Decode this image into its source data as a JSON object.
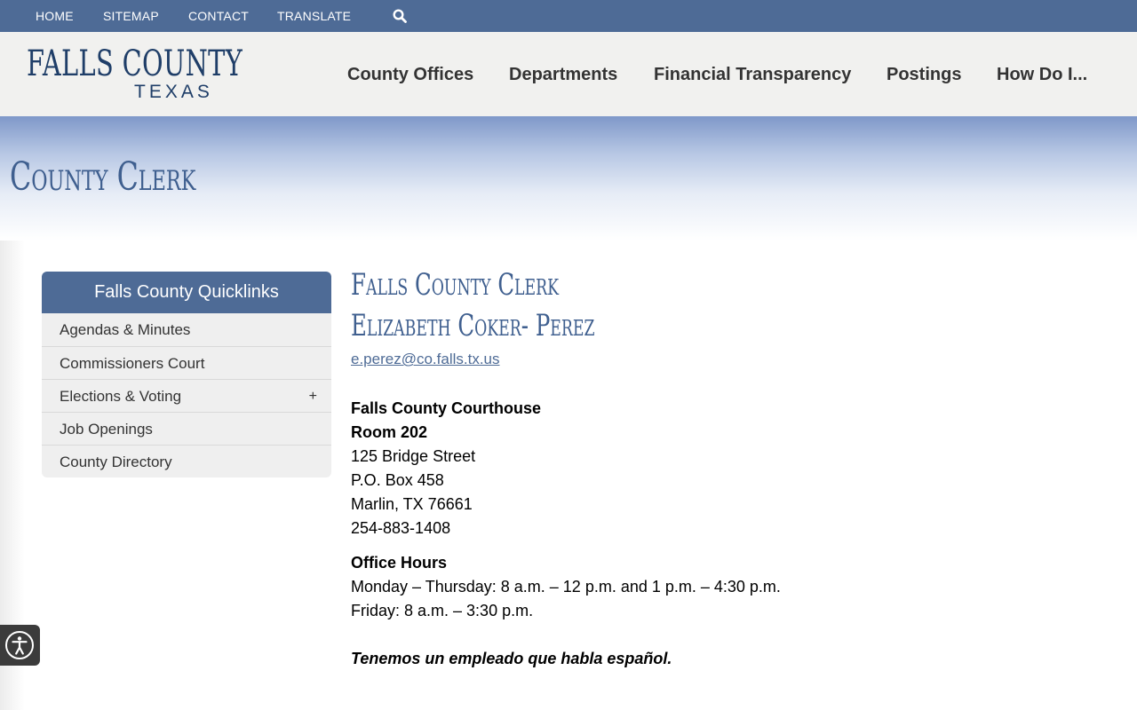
{
  "topnav": {
    "home": "HOME",
    "sitemap": "SITEMAP",
    "contact": "CONTACT",
    "translate": "TRANSLATE",
    "search_icon": "search-icon"
  },
  "logo": {
    "line1": "FALLS COUNTY",
    "line2": "TEXAS"
  },
  "mainnav": {
    "county_offices": "County Offices",
    "departments": "Departments",
    "financial_transparency": "Financial Transparency",
    "postings": "Postings",
    "how_do_i": "How Do I..."
  },
  "banner": {
    "title": "County Clerk"
  },
  "quicklinks": {
    "title": "Falls County Quicklinks",
    "items": [
      {
        "label": "Agendas & Minutes"
      },
      {
        "label": "Commissioners Court"
      },
      {
        "label": "Elections & Voting",
        "expand": "+"
      },
      {
        "label": "Job Openings"
      },
      {
        "label": "County Directory"
      }
    ]
  },
  "content": {
    "heading1": "Falls County Clerk",
    "heading2": "Elizabeth Coker- Perez",
    "email": "e.perez@co.falls.tx.us ",
    "address": {
      "building": "Falls County Courthouse",
      "room": "Room 202",
      "street": "125 Bridge Street",
      "po_box": "P.O. Box 458",
      "city": "Marlin, TX 76661",
      "phone": "254-883-1408"
    },
    "hours": {
      "title": "Office Hours",
      "weekdays": "Monday – Thursday: 8 a.m. – 12 p.m. and 1 p.m. – 4:30 p.m.",
      "friday": "Friday: 8 a.m. – 3:30 p.m."
    },
    "spanish_note": "Tenemos un empleado que habla español."
  },
  "accessibility": {
    "icon": "accessibility-icon"
  },
  "colors": {
    "brand_blue": "#4e6b96",
    "heading_blue": "#3f5f8f",
    "logo_navy": "#1f3e68"
  }
}
